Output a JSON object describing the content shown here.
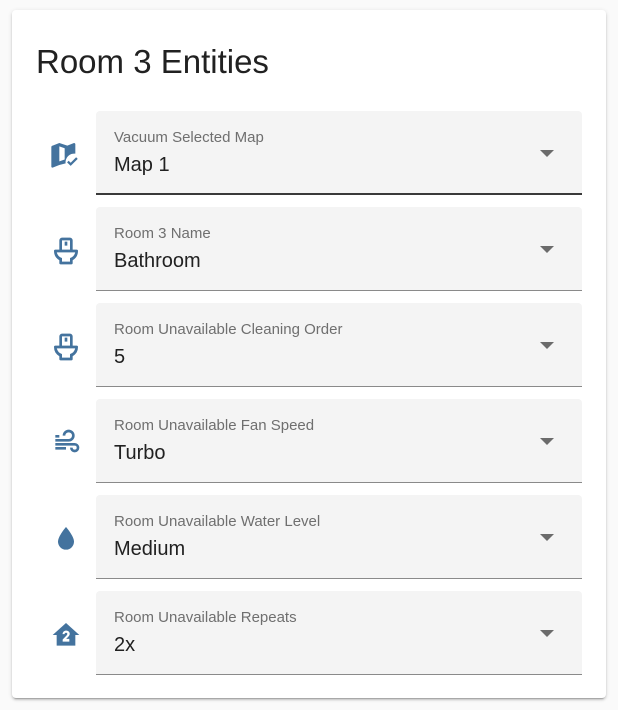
{
  "card": {
    "title": "Room 3 Entities"
  },
  "colors": {
    "icon": "#44739e",
    "field_background": "#f4f4f4",
    "label": "#6f6f6f",
    "value": "#212121"
  },
  "rows": [
    {
      "icon": "map-check-icon",
      "label": "Vacuum Selected Map",
      "value": "Map 1"
    },
    {
      "icon": "toilet-icon",
      "label": "Room 3 Name",
      "value": "Bathroom"
    },
    {
      "icon": "toilet-icon",
      "label": "Room Unavailable Cleaning Order",
      "value": "5"
    },
    {
      "icon": "fan-speed-wind-icon",
      "label": "Room Unavailable Fan Speed",
      "value": "Turbo"
    },
    {
      "icon": "water-drop-icon",
      "label": "Room Unavailable Water Level",
      "value": "Medium"
    },
    {
      "icon": "home-number-2-icon",
      "label": "Room Unavailable Repeats",
      "value": "2x"
    }
  ]
}
